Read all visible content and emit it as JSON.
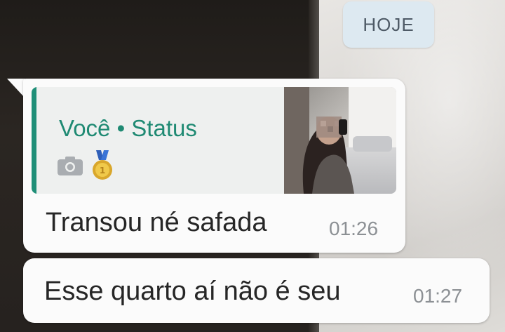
{
  "date_separator": "HOJE",
  "messages": [
    {
      "quoted": {
        "title": "Você • Status",
        "icons": [
          "camera-icon",
          "medal-icon"
        ],
        "thumbnail": "status-photo"
      },
      "text": "Transou né safada",
      "time": "01:26"
    },
    {
      "text": "Esse quarto aí não é seu",
      "time": "01:27"
    }
  ],
  "colors": {
    "bubble": "#fbfbfb",
    "quote_accent": "#1f8f78",
    "quote_title": "#1f8a73",
    "date_chip": "#dde9f1",
    "time_text": "#8c9094"
  }
}
